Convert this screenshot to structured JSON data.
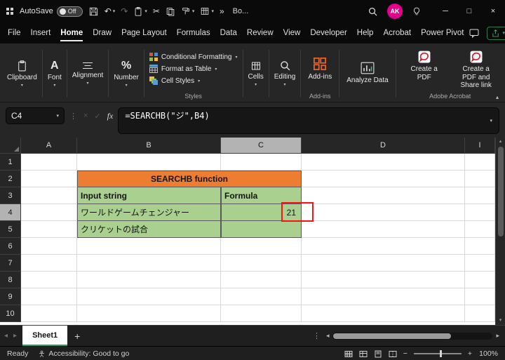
{
  "titlebar": {
    "autosave_label": "AutoSave",
    "autosave_state": "Off",
    "doc_name": "Bo...",
    "avatar_initials": "AK"
  },
  "menubar": {
    "items": [
      "File",
      "Insert",
      "Home",
      "Draw",
      "Page Layout",
      "Formulas",
      "Data",
      "Review",
      "View",
      "Developer",
      "Help",
      "Acrobat",
      "Power Pivot"
    ]
  },
  "ribbon": {
    "clipboard": "Clipboard",
    "font": "Font",
    "alignment": "Alignment",
    "number": "Number",
    "conditional_formatting": "Conditional Formatting",
    "format_as_table": "Format as Table",
    "cell_styles": "Cell Styles",
    "styles_group": "Styles",
    "cells": "Cells",
    "editing": "Editing",
    "addins": "Add-ins",
    "addins_group": "Add-ins",
    "analyze_data": "Analyze Data",
    "create_pdf": "Create a PDF",
    "create_pdf_share": "Create a PDF and Share link",
    "acrobat_group": "Adobe Acrobat"
  },
  "formula_bar": {
    "name_box": "C4",
    "fx": "fx",
    "formula": "=SEARCHB(\"ジ\",B4)"
  },
  "grid": {
    "columns": [
      "A",
      "B",
      "C",
      "D",
      "I"
    ],
    "rows": [
      "1",
      "2",
      "3",
      "4",
      "5",
      "6",
      "7",
      "8",
      "9",
      "10"
    ],
    "title_cell": "SEARCHB function",
    "b3": "Input string",
    "c3": "Formula",
    "b4": "ワールドゲームチェンジャー",
    "c4": "21",
    "b5": "クリケットの試合"
  },
  "sheet_bar": {
    "tab": "Sheet1"
  },
  "status_bar": {
    "mode": "Ready",
    "accessibility": "Accessibility: Good to go",
    "zoom": "100%"
  },
  "icons": {
    "chevron_down": "▾",
    "chevron_up": "▴",
    "overflow": "»",
    "dots_vertical": "⋮",
    "undo": "↶",
    "redo": "↷",
    "cut": "✂",
    "cancel": "×",
    "check": "✓",
    "minimize": "─",
    "maximize": "□",
    "close": "×",
    "plus": "+",
    "scroll_left": "◂",
    "scroll_right": "▸",
    "zoom_out": "−",
    "zoom_in": "+",
    "font_icon": "A",
    "number_icon": "%"
  }
}
